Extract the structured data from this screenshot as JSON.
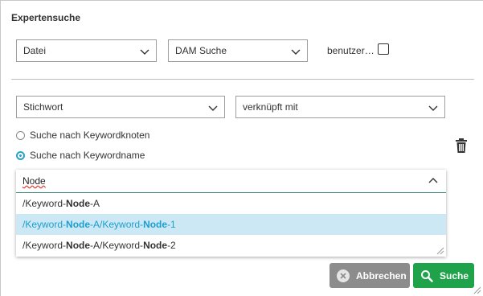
{
  "dialog": {
    "title": "Expertensuche"
  },
  "row1": {
    "select_type": "Datei",
    "select_search": "DAM Suche",
    "checkbox_label": "benutzer…",
    "checkbox_checked": false
  },
  "row2": {
    "select_field": "Stichwort",
    "select_operator": "verknüpft mit"
  },
  "radios": [
    {
      "label": "Suche nach Keywordknoten",
      "checked": false
    },
    {
      "label": "Suche nach Keywordname",
      "checked": true
    }
  ],
  "combo": {
    "value": "Node",
    "options": [
      {
        "prefix": "/Keyword-",
        "b1": "Node",
        "mid": "-A",
        "b2": "",
        "suffix": "",
        "selected": false
      },
      {
        "prefix": "/Keyword-",
        "b1": "Node",
        "mid": "-A/Keyword-",
        "b2": "Node",
        "suffix": "-1",
        "selected": true
      },
      {
        "prefix": "/Keyword-",
        "b1": "Node",
        "mid": "-A/Keyword-",
        "b2": "Node",
        "suffix": "-2",
        "selected": false
      }
    ]
  },
  "buttons": {
    "cancel": "Abbrechen",
    "search": "Suche"
  },
  "colors": {
    "accent_blue": "#29a3c8",
    "selected_bg": "#cde8f5",
    "search_green": "#1fa34a",
    "cancel_gray": "#8c8c8c"
  },
  "icons": [
    "chevron-down-icon",
    "chevron-up-icon",
    "trash-icon",
    "close-circle-icon",
    "search-icon",
    "resize-grip-icon"
  ]
}
